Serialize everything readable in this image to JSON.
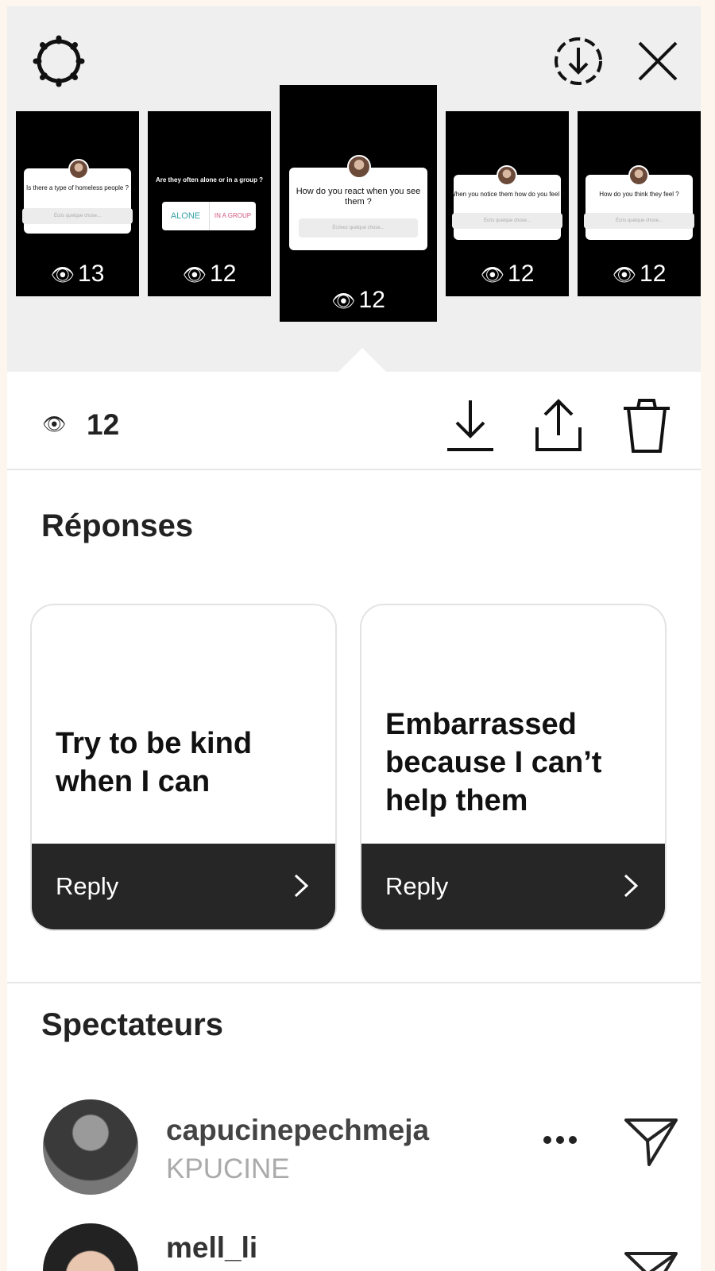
{
  "header": {
    "settings_icon": "gear-icon",
    "save_icon": "download-circle-icon",
    "close_icon": "close-icon"
  },
  "stories": [
    {
      "question": "Is there a type of homeless people ?",
      "placeholder": "Écris quelque chose...",
      "views": "13"
    },
    {
      "question": "Are they often alone or in a group ?",
      "option_a": "ALONE",
      "option_b": "IN A GROUP",
      "views": "12"
    },
    {
      "question": "How do you react when you see them ?",
      "placeholder": "Écrivez quelque chose...",
      "views": "12"
    },
    {
      "question": "When you notice them how do you feel ?",
      "placeholder": "Écris quelque chose...",
      "views": "12"
    },
    {
      "question": "How do you think they feel ?",
      "placeholder": "Écris quelque chose...",
      "views": "12"
    }
  ],
  "toolbar": {
    "view_count": "12",
    "eye_icon": "eye-icon",
    "download_icon": "download-icon",
    "share_icon": "share-icon",
    "delete_icon": "trash-icon"
  },
  "responses": {
    "title": "Réponses",
    "items": [
      {
        "text": "Try to be kind when I can",
        "button": "Reply"
      },
      {
        "text": "Embarrassed because I can’t help them",
        "button": "Reply"
      }
    ]
  },
  "viewers": {
    "title": "Spectateurs",
    "items": [
      {
        "username": "capucinepechmeja",
        "display_name": "KPUCINE"
      },
      {
        "username": "mell_li",
        "display_name": ""
      }
    ]
  }
}
